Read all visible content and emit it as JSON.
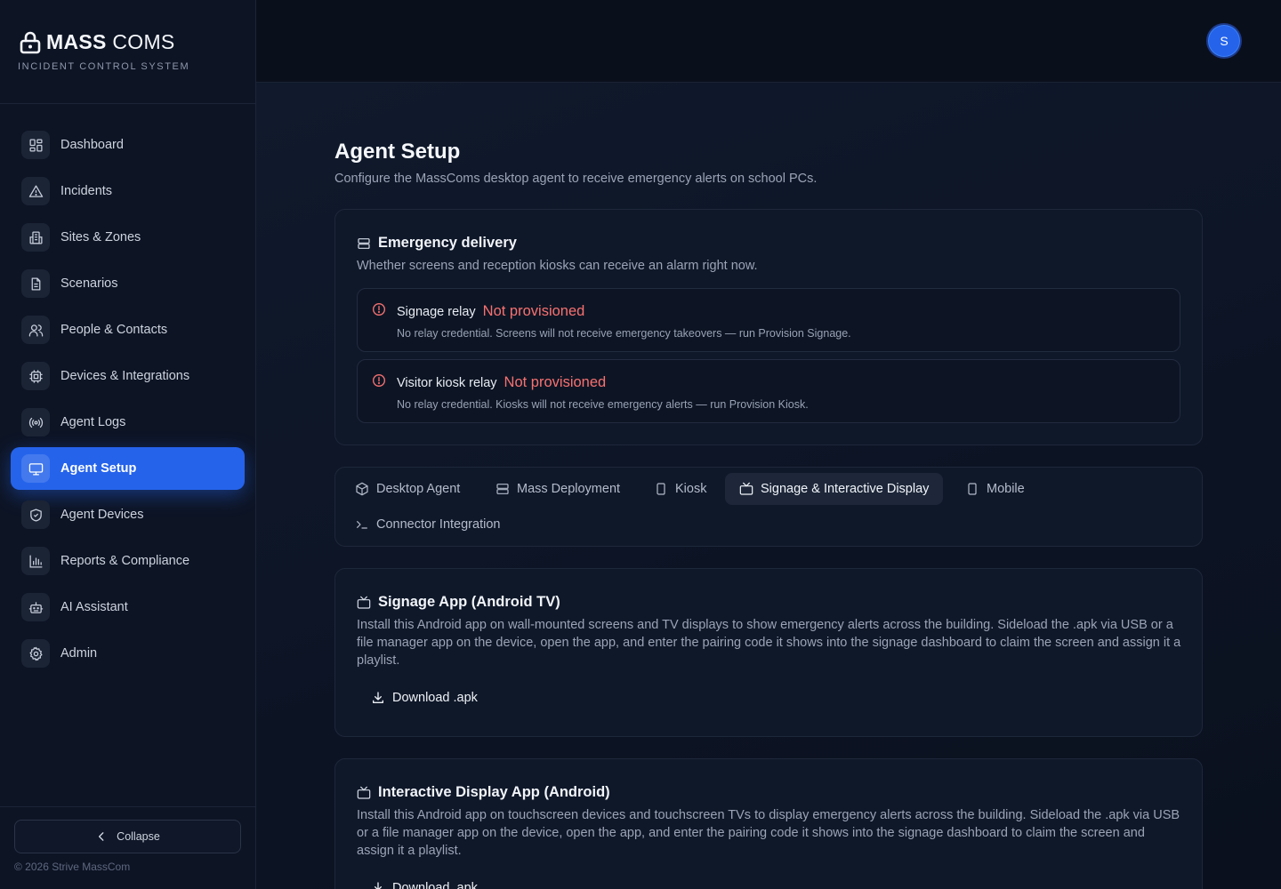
{
  "brand": {
    "name_bold": "MASS",
    "name_light": " COMS",
    "subtitle": "INCIDENT CONTROL SYSTEM"
  },
  "sidebar": {
    "items": [
      {
        "label": "Dashboard",
        "icon": "dashboard-icon"
      },
      {
        "label": "Incidents",
        "icon": "warning-triangle-icon"
      },
      {
        "label": "Sites & Zones",
        "icon": "building-icon"
      },
      {
        "label": "Scenarios",
        "icon": "document-icon"
      },
      {
        "label": "People & Contacts",
        "icon": "users-icon"
      },
      {
        "label": "Devices & Integrations",
        "icon": "chip-icon"
      },
      {
        "label": "Agent Logs",
        "icon": "broadcast-icon"
      },
      {
        "label": "Agent Setup",
        "icon": "monitor-icon",
        "active": true
      },
      {
        "label": "Agent Devices",
        "icon": "shield-icon"
      },
      {
        "label": "Reports & Compliance",
        "icon": "bar-chart-icon"
      },
      {
        "label": "AI Assistant",
        "icon": "bot-icon"
      },
      {
        "label": "Admin",
        "icon": "gear-icon"
      }
    ],
    "collapse_label": "Collapse",
    "copyright": "© 2026 Strive MassCom"
  },
  "topbar": {
    "avatar_initial": "S"
  },
  "page": {
    "title": "Agent Setup",
    "subtitle": "Configure the MassComs desktop agent to receive emergency alerts on school PCs."
  },
  "emergency": {
    "title": "Emergency delivery",
    "description": "Whether screens and reception kiosks can receive an alarm right now.",
    "relays": [
      {
        "name": "Signage relay",
        "status": "Not provisioned",
        "description": "No relay credential. Screens will not receive emergency takeovers — run Provision Signage."
      },
      {
        "name": "Visitor kiosk relay",
        "status": "Not provisioned",
        "description": "No relay credential. Kiosks will not receive emergency alerts — run Provision Kiosk."
      }
    ]
  },
  "tabs": [
    {
      "label": "Desktop Agent",
      "icon": "package-icon"
    },
    {
      "label": "Mass Deployment",
      "icon": "server-icon"
    },
    {
      "label": "Kiosk",
      "icon": "tablet-icon"
    },
    {
      "label": "Signage & Interactive Display",
      "icon": "tv-icon",
      "active": true
    },
    {
      "label": "Mobile",
      "icon": "phone-icon"
    },
    {
      "label": "Connector Integration",
      "icon": "terminal-icon"
    }
  ],
  "signage_app": {
    "title": "Signage App (Android TV)",
    "description": "Install this Android app on wall-mounted screens and TV displays to show emergency alerts across the building. Sideload the .apk via USB or a file manager app on the device, open the app, and enter the pairing code it shows into the signage dashboard to claim the screen and assign it a playlist.",
    "download_label": "Download .apk"
  },
  "interactive_app": {
    "title": "Interactive Display App (Android)",
    "description": "Install this Android app on touchscreen devices and touchscreen TVs to display emergency alerts across the building. Sideload the .apk via USB or a file manager app on the device, open the app, and enter the pairing code it shows into the signage dashboard to claim the screen and assign it a playlist.",
    "download_label": "Download .apk"
  },
  "colors": {
    "accent": "#2563eb",
    "danger": "#f87171"
  }
}
